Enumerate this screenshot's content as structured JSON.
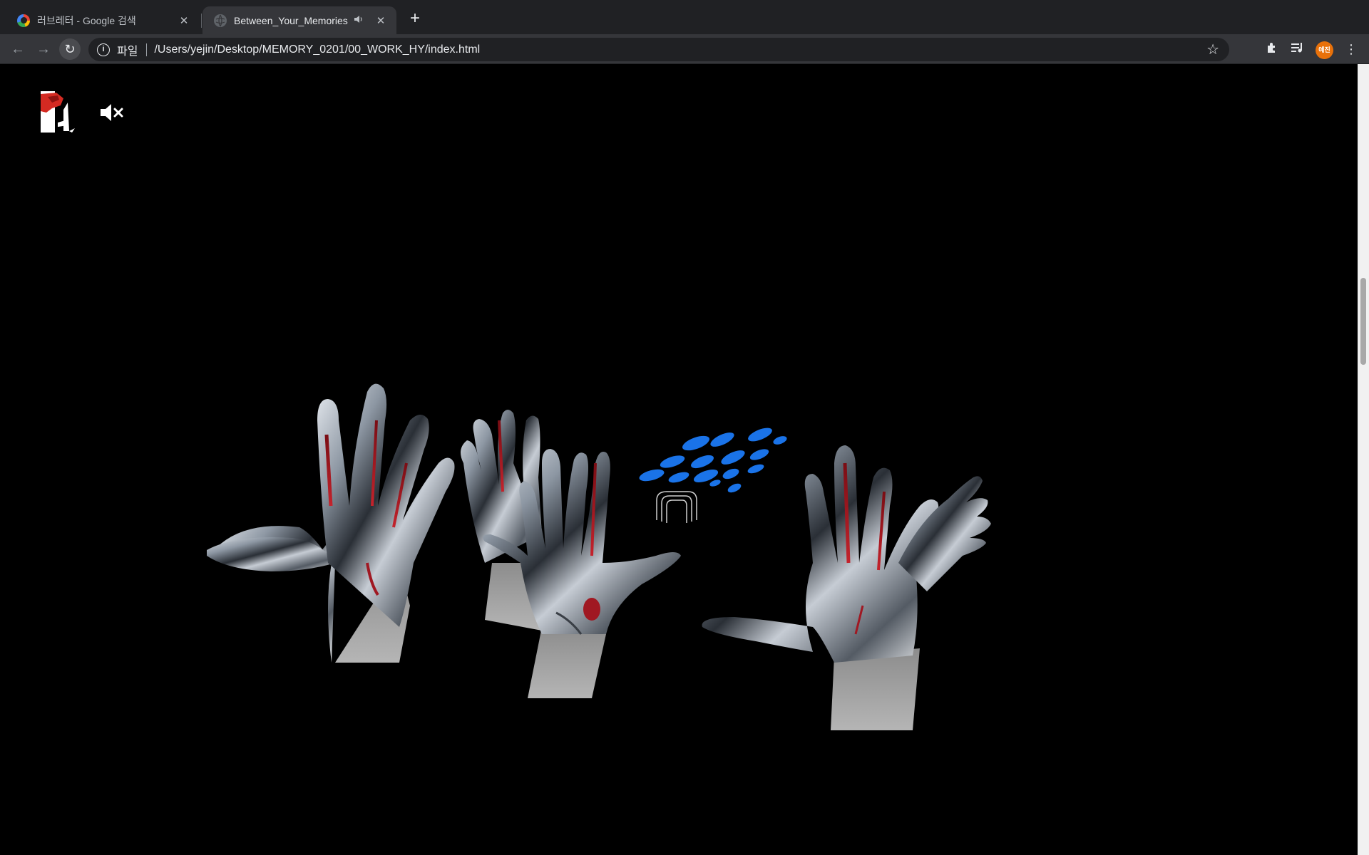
{
  "browser": {
    "tabs": [
      {
        "title": "러브레터 - Google 검색",
        "active": false,
        "favicon": "google-icon"
      },
      {
        "title": "Between_Your_Memories",
        "active": true,
        "favicon": "globe-icon",
        "audio": "speaker-icon"
      }
    ],
    "close_label": "✕",
    "new_tab_label": "+",
    "address": {
      "scheme_label": "파일",
      "url": "/Users/yejin/Desktop/MEMORY_0201/00_WORK_HY/index.html"
    },
    "profile_initials": "예진"
  },
  "page": {
    "background": "#000000",
    "accent_blue": "#1a73e8",
    "mute_icon": "speaker-muted-icon",
    "logo_icon": "logo-icon",
    "scene_objects": [
      "chrome-hand-left",
      "chrome-hands-center",
      "chrome-hands-right",
      "blue-ellipse-swarm"
    ]
  }
}
